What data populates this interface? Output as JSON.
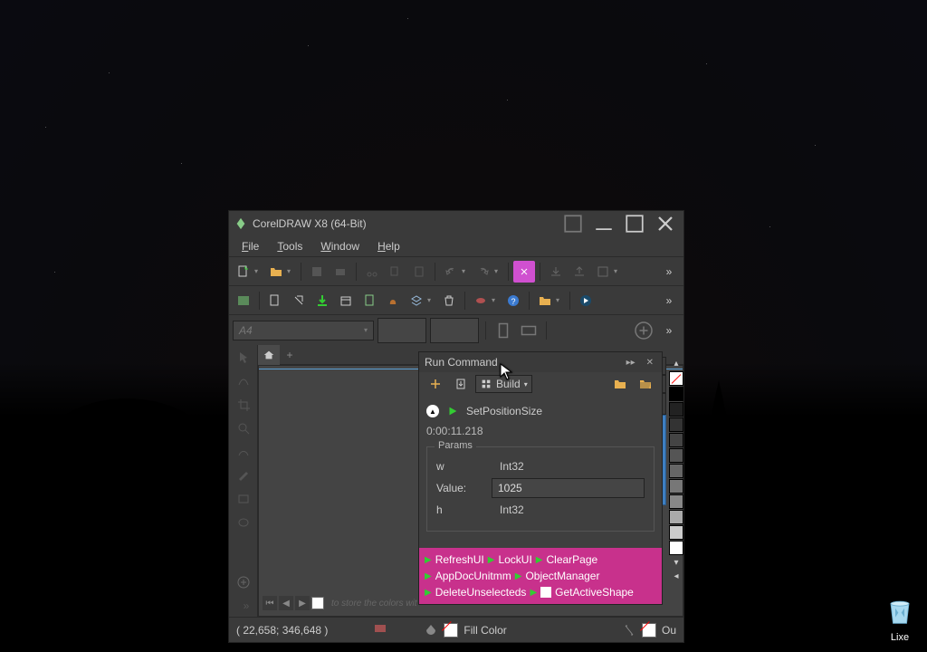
{
  "app": {
    "title": "CorelDRAW X8 (64-Bit)"
  },
  "menu": {
    "items": [
      "File",
      "Tools",
      "Window",
      "Help"
    ]
  },
  "propbar": {
    "paper": "A4"
  },
  "docker": {
    "title": "Run Command",
    "build_label": "Build",
    "command_name": "SetPositionSize",
    "elapsed": "0:00:11.218",
    "params_legend": "Params",
    "rows": {
      "w": {
        "name": "w",
        "type": "Int32"
      },
      "value": {
        "label": "Value:",
        "value": "1025"
      },
      "h": {
        "name": "h",
        "type": "Int32"
      }
    }
  },
  "quick": {
    "row1": [
      "RefreshUI",
      "LockUI",
      "ClearPage"
    ],
    "row2": [
      "AppDocUnitmm",
      "ObjectManager"
    ],
    "row3": [
      "DeleteUnselecteds",
      "GetActiveShape"
    ]
  },
  "right_tab": {
    "active": "Run Command"
  },
  "status": {
    "coords": "( 22,658; 346,648 )",
    "fill_label": "Fill Color",
    "outline_prefix": "Ou"
  },
  "pagenav": {
    "hint": "to store the colors wit"
  },
  "desktop": {
    "recycle_label": "Lixe"
  }
}
